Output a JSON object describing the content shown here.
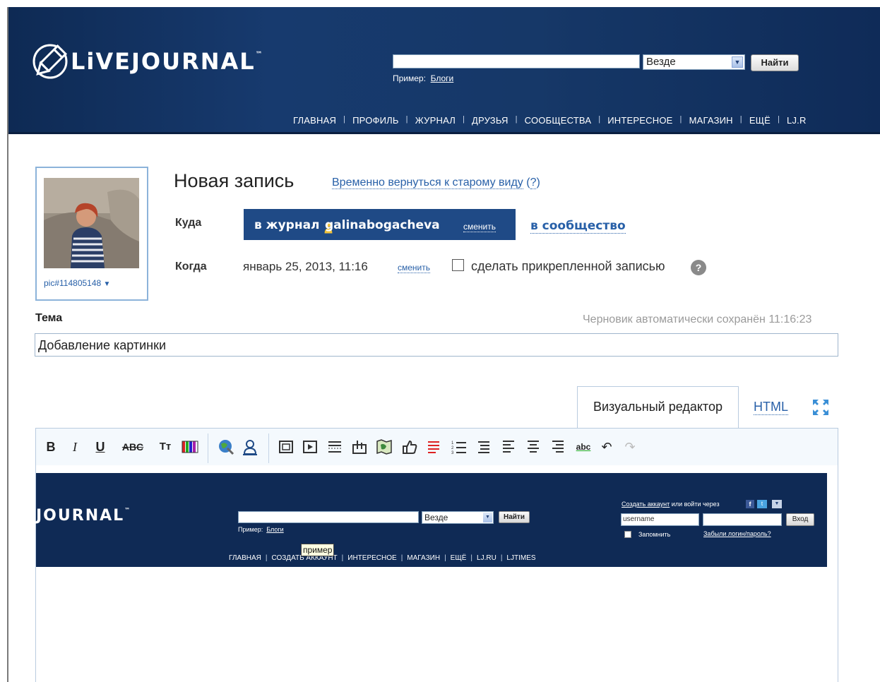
{
  "header": {
    "logo_text": "LiVEJOURNAL",
    "logo_tm": "™",
    "search": {
      "value": "",
      "scope": "Везде",
      "button": "Найти",
      "hint_prefix": "Пример:",
      "hint_link": "Блоги"
    },
    "nav": [
      "ГЛАВНАЯ",
      "ПРОФИЛЬ",
      "ЖУРНАЛ",
      "ДРУЗЬЯ",
      "СООБЩЕСТВА",
      "ИНТЕРЕСНОЕ",
      "МАГАЗИН",
      "ЕЩЁ",
      "LJ.R"
    ]
  },
  "userpic": {
    "label": "pic#114805148",
    "arrow": "▼"
  },
  "post": {
    "title": "Новая запись",
    "old_view_link": "Временно вернуться к старому виду",
    "old_view_help": "?",
    "where_label": "Куда",
    "journal_label": "в журнал",
    "username": "galinabogacheva",
    "change_journal": "сменить",
    "to_community": "в сообщество",
    "when_label": "Когда",
    "date": "январь 25, 2013, 11:16",
    "change_date": "сменить",
    "sticky_label": "сделать прикрепленной записью",
    "sticky_checked": false,
    "help_icon": "?"
  },
  "subject": {
    "label": "Тема",
    "draft_status": "Черновик автоматически сохранён 11:16:23",
    "value": "Добавление картинки"
  },
  "editor": {
    "tab_visual": "Визуальный редактор",
    "tab_html": "HTML",
    "toolbar": {
      "bold": "B",
      "italic": "I",
      "underline": "U",
      "strike": "ABC",
      "text_size": "Tт",
      "spell": "abc"
    }
  },
  "embedded_image": {
    "logo_text": "JOURNAL",
    "logo_tm": "™",
    "search_scope": "Везде",
    "search_button": "Найти",
    "hint_prefix": "Пример:",
    "hint_link": "Блоги",
    "nav": [
      "ГЛАВНАЯ",
      "СОЗДАТЬ АККАУНТ",
      "ИНТЕРЕСНОЕ",
      "МАГАЗИН",
      "ЕЩЁ",
      "LJ.RU",
      "LJTIMES"
    ],
    "account_link": "Создать аккаунт",
    "account_text": "или войти через",
    "username_value": "username",
    "login_button": "Вход",
    "remember": "Запомнить",
    "forgot": "Забыли логин/пароль?",
    "tooltip": "пример"
  },
  "colors": {
    "header_bg": "#173a6e",
    "link": "#2860a8",
    "journal_pill": "#1f4a86"
  }
}
